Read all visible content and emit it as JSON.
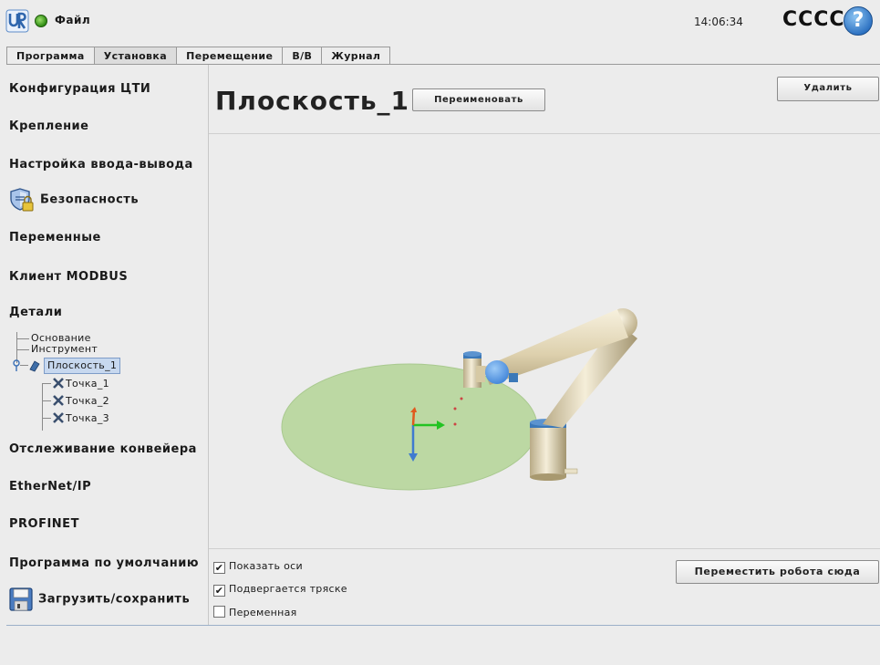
{
  "header": {
    "file_menu": "Файл",
    "clock": "14:06:34",
    "robot_name": "CCCC",
    "help_symbol": "?"
  },
  "tabs": [
    {
      "label": "Программа",
      "active": false
    },
    {
      "label": "Установка",
      "active": true
    },
    {
      "label": "Перемещение",
      "active": false
    },
    {
      "label": "В/В",
      "active": false
    },
    {
      "label": "Журнал",
      "active": false
    }
  ],
  "sidebar": {
    "items": [
      {
        "label": "Конфигурация ЦТИ"
      },
      {
        "label": "Крепление"
      },
      {
        "label": "Настройка ввода-вывода"
      },
      {
        "label": "Безопасность",
        "icon": "shield-lock-icon"
      },
      {
        "label": "Переменные"
      },
      {
        "label": "Клиент MODBUS"
      },
      {
        "label": "Детали"
      },
      {
        "label": "Отслеживание конвейера"
      },
      {
        "label": "EtherNet/IP"
      },
      {
        "label": "PROFINET"
      },
      {
        "label": "Программа по умолчанию"
      },
      {
        "label": "Загрузить/сохранить",
        "icon": "floppy-disk-icon"
      }
    ],
    "tree": [
      {
        "label": "Основание"
      },
      {
        "label": "Инструмент"
      },
      {
        "label": "Плоскость_1",
        "selected": true
      },
      {
        "label": "Точка_1"
      },
      {
        "label": "Точка_2"
      },
      {
        "label": "Точка_3"
      }
    ]
  },
  "main": {
    "title": "Плоскость_1",
    "rename_button": "Переименовать",
    "delete_button": "Удалить",
    "move_robot_button": "Переместить робота сюда",
    "checkboxes": [
      {
        "label": "Показать оси",
        "checked": true
      },
      {
        "label": "Подвергается тряске",
        "checked": true
      },
      {
        "label": "Переменная",
        "checked": false
      }
    ],
    "check_mark": "✔"
  },
  "colors": {
    "plane_fill": "#bcd8a3",
    "robot_body": "#e7dcc0",
    "joint_cap": "#3b78b8",
    "tool_sphere": "#4f97ea",
    "axis_x": "#22c322",
    "axis_y": "#e05a1e",
    "axis_z": "#3f7bd0"
  }
}
